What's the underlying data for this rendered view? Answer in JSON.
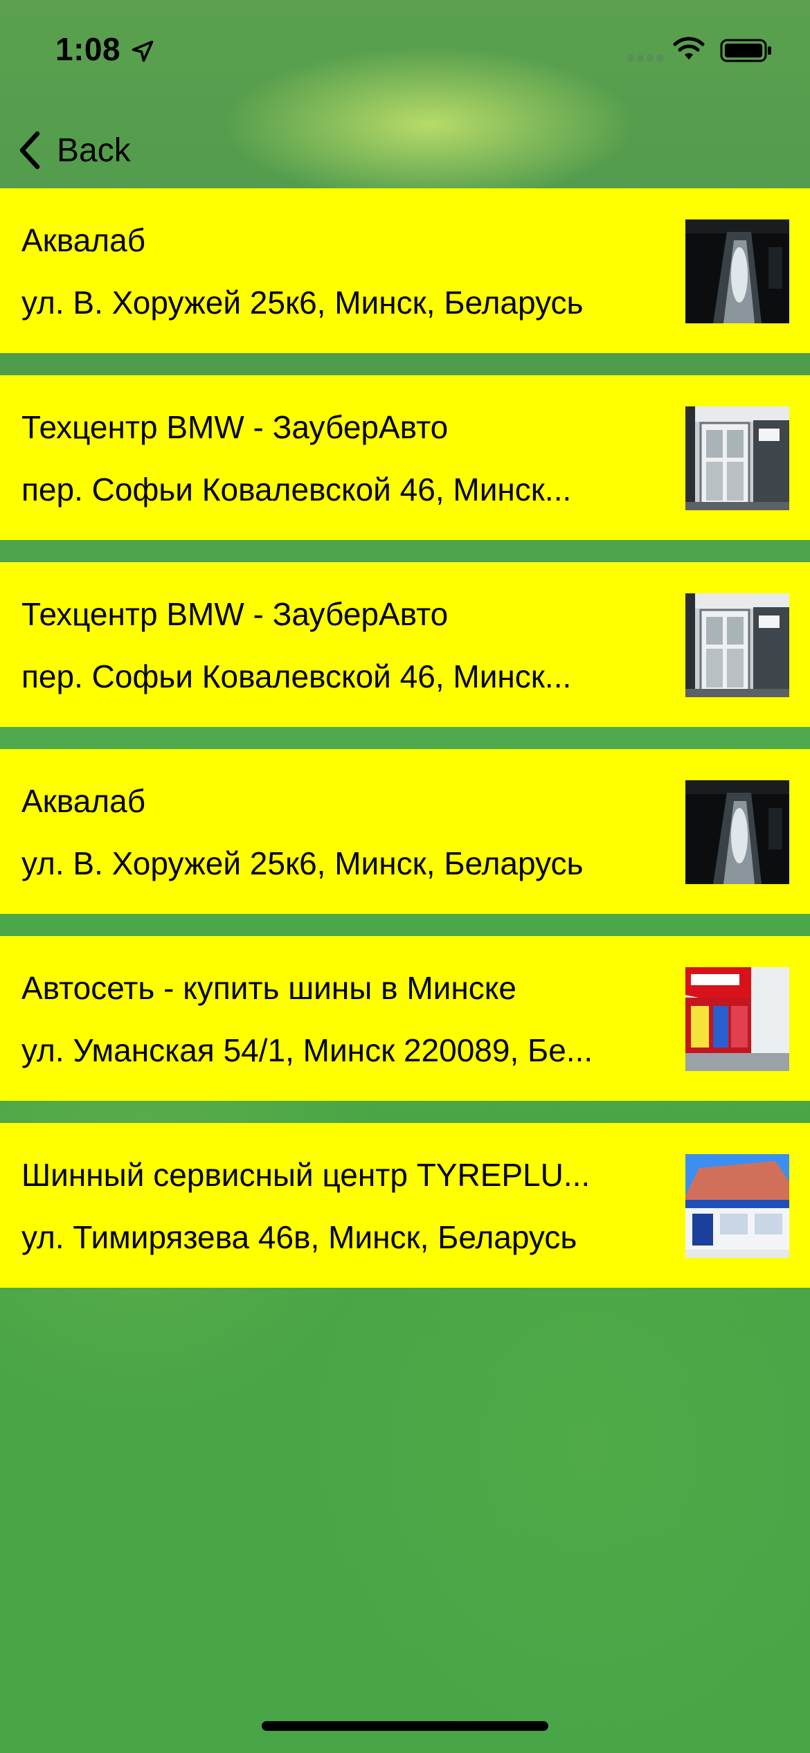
{
  "status_bar": {
    "time": "1:08"
  },
  "nav": {
    "back_label": "Back"
  },
  "places": [
    {
      "name": "Аквалаб",
      "address": "ул. В. Хоружей 25к6, Минск, Беларусь",
      "thumb": "car-wash-photo"
    },
    {
      "name": "Техцентр BMW - ЗауберАвто",
      "address": "пер. Софьи Ковалевской 46, Минск...",
      "thumb": "garage-door-photo"
    },
    {
      "name": "Техцентр BMW - ЗауберАвто",
      "address": "пер. Софьи Ковалевской 46, Минск...",
      "thumb": "garage-door-photo"
    },
    {
      "name": "Аквалаб",
      "address": "ул. В. Хоружей 25к6, Минск, Беларусь",
      "thumb": "car-wash-photo"
    },
    {
      "name": "Автосеть - купить шины в Минске",
      "address": "ул. Уманская 54/1, Минск 220089, Бе...",
      "thumb": "tire-shop-photo"
    },
    {
      "name": "Шинный сервисный центр TYREPLU...",
      "address": "ул. Тимирязева 46в, Минск, Беларусь",
      "thumb": "service-center-photo"
    }
  ],
  "colors": {
    "card_background": "#ffff00",
    "background": "#4ea64a"
  }
}
